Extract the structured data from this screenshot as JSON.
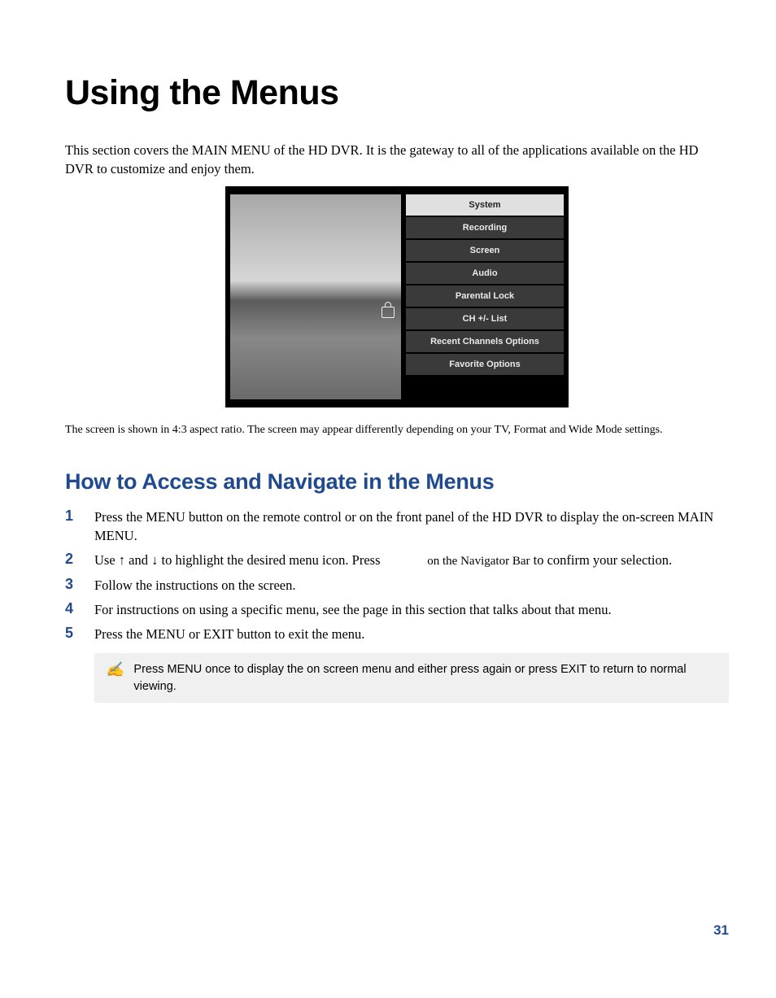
{
  "title": "Using the Menus",
  "intro": "This section covers the MAIN MENU of the HD DVR. It is the gateway to all of the applications available on the HD DVR to customize and enjoy them.",
  "menu": {
    "items": [
      "System",
      "Recording",
      "Screen",
      "Audio",
      "Parental Lock",
      "CH +/- List",
      "Recent Channels Options",
      "Favorite Options"
    ]
  },
  "caption": "The screen is shown in 4:3 aspect ratio. The screen may appear differently depending on your TV, Format and Wide Mode settings.",
  "subheading": "How to Access and Navigate in the Menus",
  "steps": {
    "s1": {
      "num": "1",
      "text": "Press the MENU button on the remote control or on the front panel of the HD DVR to display the on-screen MAIN MENU."
    },
    "s2": {
      "num": "2",
      "pre": "Use ",
      "up": "↑",
      "mid1": " and ",
      "down": "↓",
      "mid2": " to highlight the desired menu icon. Press ",
      "navbar": "on the Navigator Bar",
      "tail": " to confirm your selection."
    },
    "s3": {
      "num": "3",
      "text": "Follow the instructions on the screen."
    },
    "s4": {
      "num": "4",
      "text": "For instructions on using a specific menu, see the page in this section that talks about that menu."
    },
    "s5": {
      "num": "5",
      "text": "Press the MENU or EXIT button to exit the menu."
    }
  },
  "note": {
    "icon": "✍",
    "text": "Press MENU once to display the on screen menu and either press again or press EXIT to return to normal viewing."
  },
  "page_number": "31"
}
